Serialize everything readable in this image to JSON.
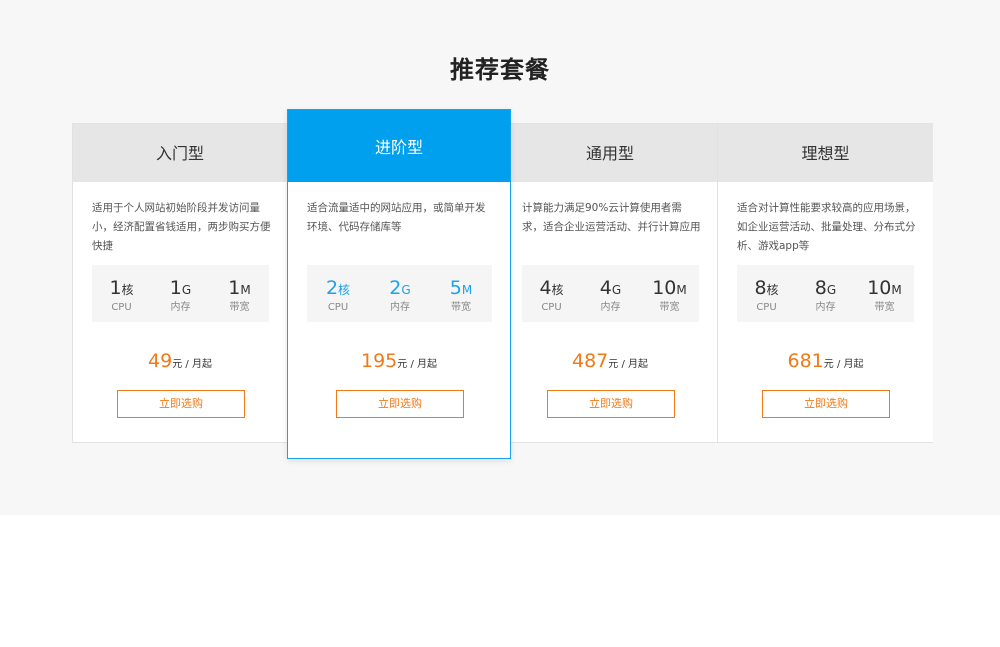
{
  "section": {
    "title": "推荐套餐"
  },
  "colors": {
    "accent": "#f07a18",
    "featured": "#00a0ee"
  },
  "plans": [
    {
      "name": "入门型",
      "desc": "适用于个人网站初始阶段并发访问量小，经济配置省钱适用，两步购买方便快捷",
      "specs": [
        {
          "num": "1",
          "unit": "核",
          "label": "CPU"
        },
        {
          "num": "1",
          "unit": "G",
          "label": "内存"
        },
        {
          "num": "1",
          "unit": "M",
          "label": "带宽"
        }
      ],
      "price": "49",
      "price_suffix": "元 / 月起",
      "button": "立即选购"
    },
    {
      "name": "进阶型",
      "desc": "适合流量适中的网站应用，或简单开发环境、代码存储库等",
      "specs": [
        {
          "num": "2",
          "unit": "核",
          "label": "CPU"
        },
        {
          "num": "2",
          "unit": "G",
          "label": "内存"
        },
        {
          "num": "5",
          "unit": "M",
          "label": "带宽"
        }
      ],
      "price": "195",
      "price_suffix": "元 / 月起",
      "button": "立即选购"
    },
    {
      "name": "通用型",
      "desc": "计算能力满足90%云计算使用者需求，适合企业运营活动、并行计算应用",
      "specs": [
        {
          "num": "4",
          "unit": "核",
          "label": "CPU"
        },
        {
          "num": "4",
          "unit": "G",
          "label": "内存"
        },
        {
          "num": "10",
          "unit": "M",
          "label": "带宽"
        }
      ],
      "price": "487",
      "price_suffix": "元 / 月起",
      "button": "立即选购"
    },
    {
      "name": "理想型",
      "desc": "适合对计算性能要求较高的应用场景，如企业运营活动、批量处理、分布式分析、游戏app等",
      "specs": [
        {
          "num": "8",
          "unit": "核",
          "label": "CPU"
        },
        {
          "num": "8",
          "unit": "G",
          "label": "内存"
        },
        {
          "num": "10",
          "unit": "M",
          "label": "带宽"
        }
      ],
      "price": "681",
      "price_suffix": "元 / 月起",
      "button": "立即选购"
    }
  ]
}
